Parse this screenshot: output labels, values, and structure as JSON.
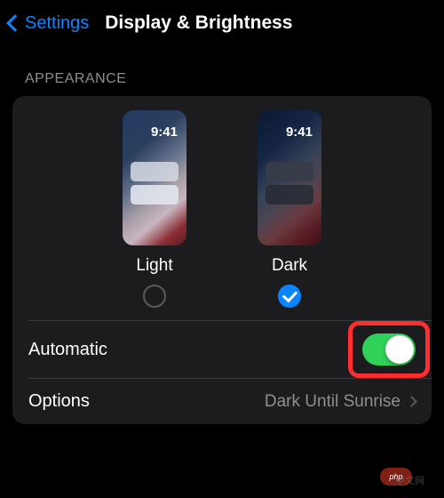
{
  "header": {
    "back_label": "Settings",
    "title": "Display & Brightness"
  },
  "appearance": {
    "section_label": "APPEARANCE",
    "preview_time": "9:41",
    "options": [
      {
        "label": "Light",
        "selected": false
      },
      {
        "label": "Dark",
        "selected": true
      }
    ]
  },
  "rows": {
    "automatic": {
      "label": "Automatic",
      "on": true
    },
    "options": {
      "label": "Options",
      "value": "Dark Until Sunrise"
    }
  },
  "watermark": {
    "bubble": "php",
    "text": "中文网"
  }
}
